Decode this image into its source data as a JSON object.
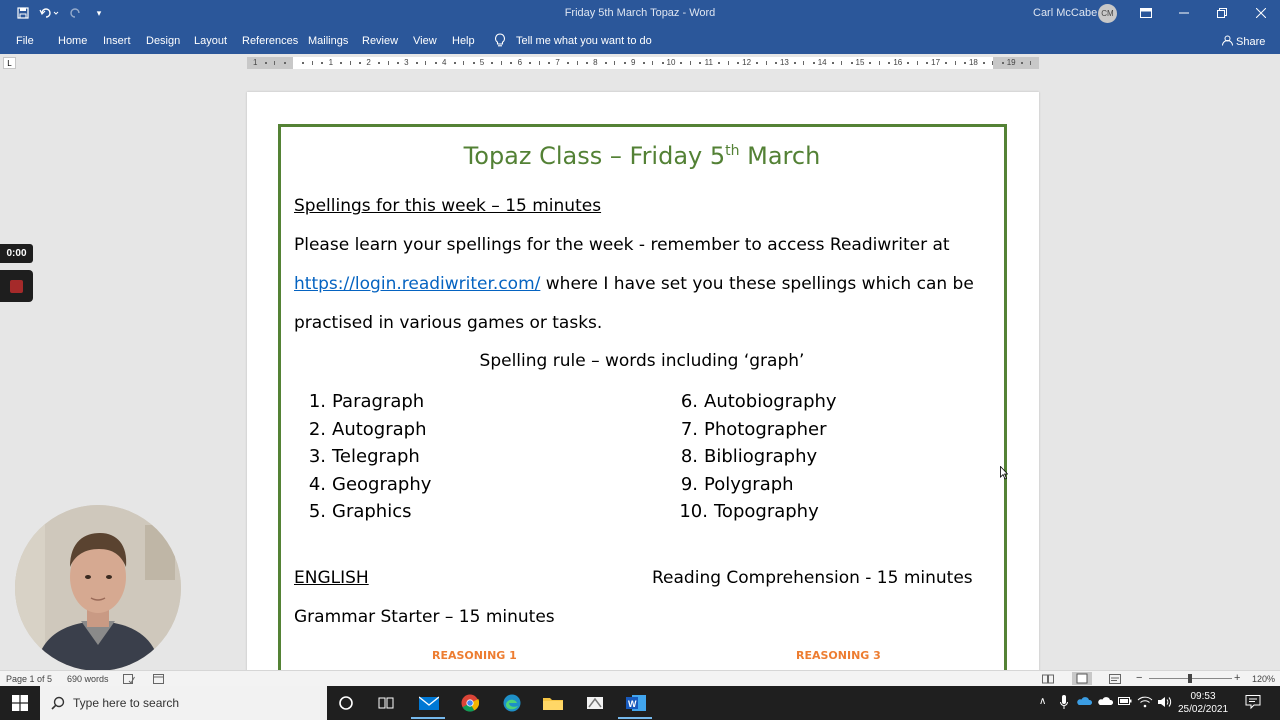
{
  "window": {
    "title": "Friday 5th March Topaz  -  Word",
    "user_name": "Carl McCabe",
    "user_initials": "CM"
  },
  "ribbon": {
    "tabs": [
      "File",
      "Home",
      "Insert",
      "Design",
      "Layout",
      "References",
      "Mailings",
      "Review",
      "View",
      "Help"
    ],
    "tell_me": "Tell me what you want to do",
    "share": "Share"
  },
  "ruler": {
    "ticks": [
      "1",
      "2",
      "1",
      "2",
      "3",
      "4",
      "5",
      "6",
      "7",
      "8",
      "9",
      "10",
      "11",
      "12",
      "13",
      "14",
      "15",
      "16",
      "17",
      "18",
      "19"
    ]
  },
  "document": {
    "title_pre": "Topaz Class – Friday 5",
    "title_sup": "th",
    "title_post": " March",
    "spellings_heading": "Spellings for this week – 15 minutes",
    "para_line1": "Please learn your spellings for the week - remember to access Readiwriter at",
    "link": "https://login.readiwriter.com/",
    "para_line2_rest": " where I have set you these spellings which can be",
    "para_line3": "practised in various games or tasks.",
    "spelling_rule": "Spelling rule – words including ‘graph’",
    "list_left": [
      {
        "num": "1.",
        "word": "Paragraph"
      },
      {
        "num": "2.",
        "word": "Autograph"
      },
      {
        "num": "3.",
        "word": "Telegraph"
      },
      {
        "num": "4.",
        "word": "Geography"
      },
      {
        "num": "5.",
        "word": "Graphics"
      }
    ],
    "list_right": [
      {
        "num": "6.",
        "word": "Autobiography"
      },
      {
        "num": "7.",
        "word": "Photographer"
      },
      {
        "num": "8.",
        "word": "Bibliography"
      },
      {
        "num": "9.",
        "word": "Polygraph"
      },
      {
        "num": "10.",
        "word": "Topography"
      }
    ],
    "english": "ENGLISH",
    "reading": "Reading Comprehension - 15 minutes",
    "grammar": "Grammar Starter – 15 minutes",
    "reasoning_1": "REASONING 1",
    "reasoning_3": "REASONING 3",
    "frame_color": "#548235",
    "title_color": "#538135",
    "link_color": "#0563c1",
    "reasoning_color": "#ed7d31"
  },
  "recording": {
    "timer": "0:00"
  },
  "status": {
    "page": "Page 1 of 5",
    "words": "690 words",
    "zoom": "120%"
  },
  "taskbar": {
    "search_placeholder": "Type here to search",
    "time": "09:53",
    "date": "25/02/2021"
  },
  "colors": {
    "word_blue": "#2b579a"
  }
}
